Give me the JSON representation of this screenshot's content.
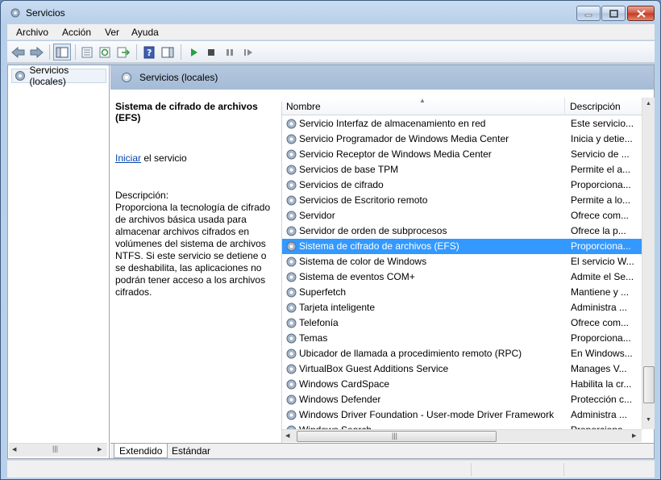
{
  "window": {
    "title": "Servicios",
    "title_icon": "gear-icon"
  },
  "menu": [
    "Archivo",
    "Acción",
    "Ver",
    "Ayuda"
  ],
  "toolbar": {
    "buttons": [
      "back-arrow-icon",
      "forward-arrow-icon",
      "show-hide-tree-icon",
      "properties-icon",
      "refresh-icon",
      "export-list-icon",
      "help-icon",
      "show-hide-action-pane-icon",
      "start-service-icon",
      "stop-service-icon",
      "pause-service-icon",
      "restart-service-icon"
    ]
  },
  "tree": {
    "root_label": "Servicios (locales)"
  },
  "right_header": {
    "label": "Servicios (locales)"
  },
  "details": {
    "title": "Sistema de cifrado de archivos (EFS)",
    "link_text": "Iniciar",
    "link_suffix": " el servicio",
    "description_label": "Descripción:",
    "description_text": "Proporciona la tecnología de cifrado de archivos básica usada para almacenar archivos cifrados en volúmenes del sistema de archivos NTFS. Si este servicio se detiene o se deshabilita, las aplicaciones no podrán tener acceso a los archivos cifrados."
  },
  "columns": {
    "name": "Nombre",
    "description": "Descripción"
  },
  "services": [
    {
      "name": "Servicio Interfaz de almacenamiento en red",
      "description": "Este servicio..."
    },
    {
      "name": "Servicio Programador de Windows Media Center",
      "description": "Inicia y detie..."
    },
    {
      "name": "Servicio Receptor de Windows Media Center",
      "description": "Servicio de ..."
    },
    {
      "name": "Servicios de base TPM",
      "description": "Permite el a..."
    },
    {
      "name": "Servicios de cifrado",
      "description": "Proporciona..."
    },
    {
      "name": "Servicios de Escritorio remoto",
      "description": "Permite a lo..."
    },
    {
      "name": "Servidor",
      "description": "Ofrece com..."
    },
    {
      "name": "Servidor de orden de subprocesos",
      "description": "Ofrece la p..."
    },
    {
      "name": "Sistema de cifrado de archivos (EFS)",
      "description": "Proporciona...",
      "selected": true
    },
    {
      "name": "Sistema de color de Windows",
      "description": "El servicio W..."
    },
    {
      "name": "Sistema de eventos COM+",
      "description": "Admite el Se..."
    },
    {
      "name": "Superfetch",
      "description": "Mantiene y ..."
    },
    {
      "name": "Tarjeta inteligente",
      "description": "Administra ..."
    },
    {
      "name": "Telefonía",
      "description": "Ofrece com..."
    },
    {
      "name": "Temas",
      "description": "Proporciona..."
    },
    {
      "name": "Ubicador de llamada a procedimiento remoto (RPC)",
      "description": "En Windows..."
    },
    {
      "name": "VirtualBox Guest Additions Service",
      "description": "Manages V..."
    },
    {
      "name": "Windows CardSpace",
      "description": "Habilita la cr..."
    },
    {
      "name": "Windows Defender",
      "description": "Protección c..."
    },
    {
      "name": "Windows Driver Foundation - User-mode Driver Framework",
      "description": "Administra ..."
    },
    {
      "name": "Windows Search",
      "description": "Proporciona..."
    }
  ],
  "tabs": [
    "Extendido",
    "Estándar"
  ],
  "colors": {
    "selection": "#3399ff",
    "header_band": "#a5bbd6",
    "link": "#0645ad"
  }
}
